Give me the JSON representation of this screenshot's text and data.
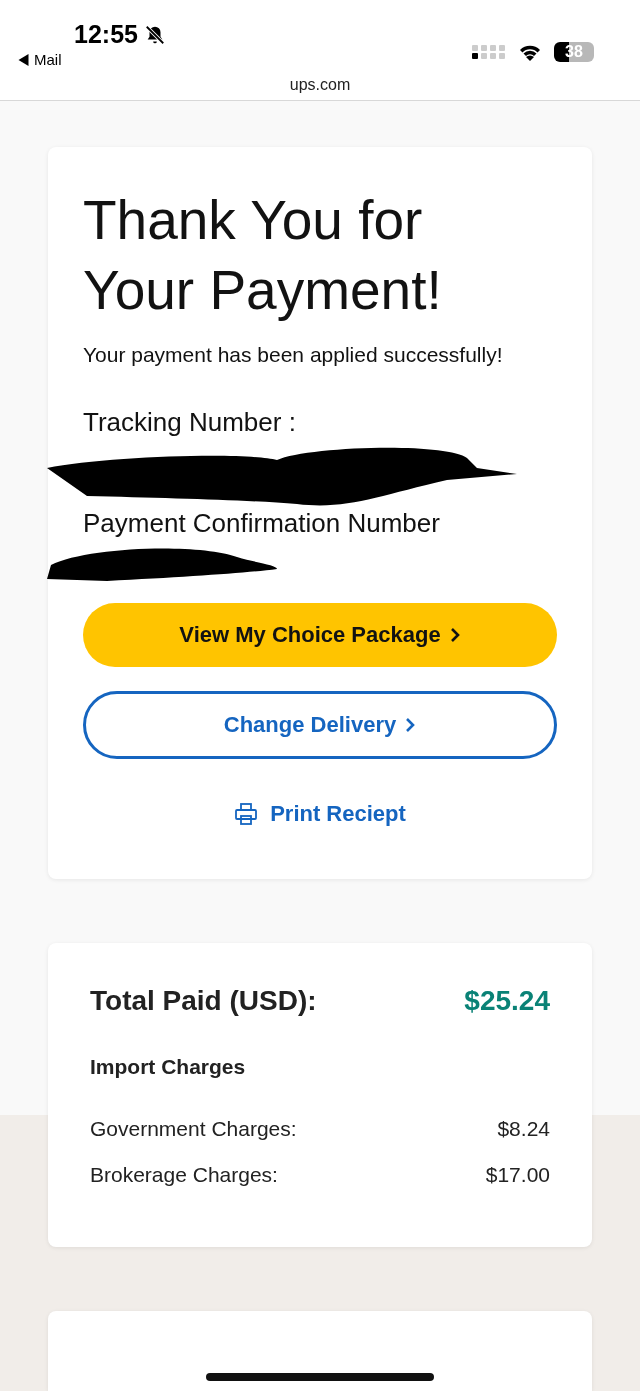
{
  "status_bar": {
    "time": "12:55",
    "silenced": true,
    "back_label": "Mail",
    "battery": "38"
  },
  "address_bar": {
    "url": "ups.com"
  },
  "confirmation": {
    "title": "Thank You for Your Payment!",
    "message": "Your payment has been applied successfully!",
    "tracking_label": "Tracking Number :",
    "tracking_redacted": true,
    "confirmation_label": "Payment Confirmation Number",
    "confirmation_redacted": true,
    "buttons": [
      {
        "kind": "primary",
        "label": "View My Choice Package"
      },
      {
        "kind": "outline",
        "label": "Change Delivery"
      }
    ],
    "print_link": "Print Reciept"
  },
  "summary": {
    "total_label": "Total Paid (USD):",
    "total_value": "$25.24",
    "section_title": "Import Charges",
    "rows": [
      {
        "label": "Government Charges:",
        "value": "$8.24"
      },
      {
        "label": "Brokerage Charges:",
        "value": "$17.00"
      }
    ]
  }
}
